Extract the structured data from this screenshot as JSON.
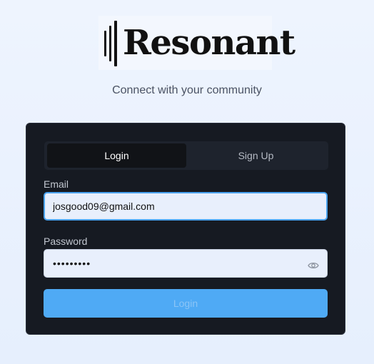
{
  "brand": {
    "name": "Resonant",
    "tagline": "Connect with your community"
  },
  "auth": {
    "tabs": [
      {
        "label": "Login",
        "active": true
      },
      {
        "label": "Sign Up",
        "active": false
      }
    ],
    "email_label": "Email",
    "email_value": "josgood09@gmail.com",
    "password_label": "Password",
    "password_value": "ilovecats",
    "submit_label": "Login",
    "submit_disabled": true
  },
  "icons": {
    "password_toggle": "eye-icon"
  },
  "colors": {
    "accent": "#4faaf5",
    "card_bg": "#161a22",
    "page_bg": "#e9f1fd"
  }
}
